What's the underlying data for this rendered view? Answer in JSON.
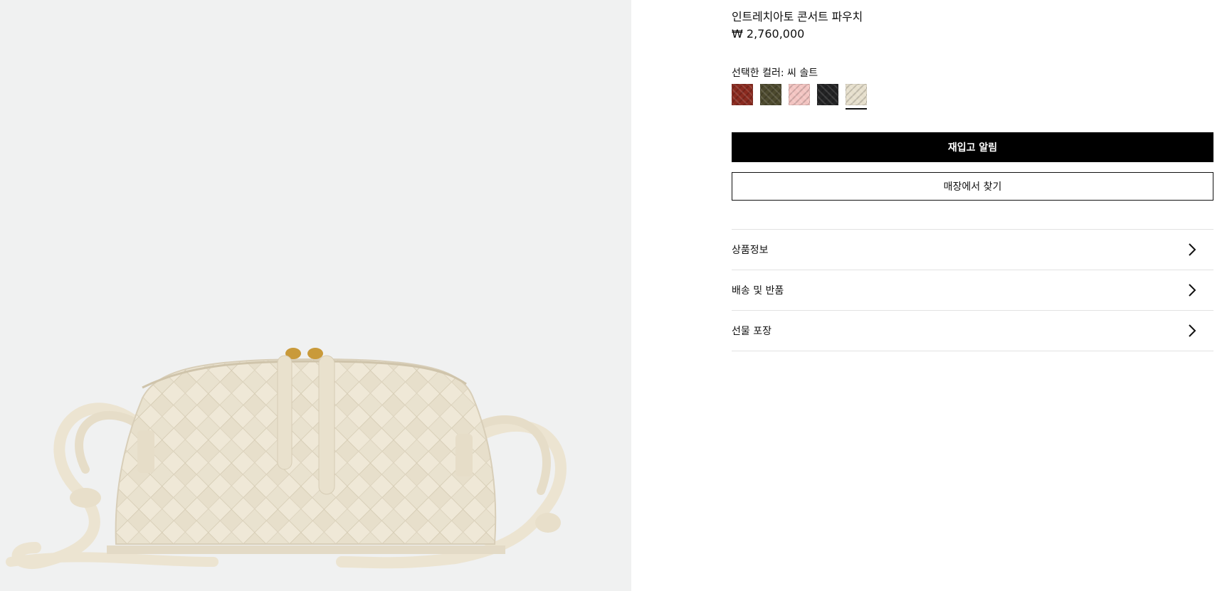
{
  "product": {
    "title": "인트레치아토 콘서트 파우치",
    "price": "₩ 2,760,000"
  },
  "color": {
    "label": "선택한 컬러: 씨 솔트",
    "selected_index": 4,
    "swatches": [
      {
        "color": "#8a2a1f"
      },
      {
        "color": "#4d4a2e"
      },
      {
        "color": "#f3c4c1"
      },
      {
        "color": "#222324"
      },
      {
        "color": "#e6dfcc"
      }
    ]
  },
  "actions": {
    "notify_label": "재입고 알림",
    "store_label": "매장에서 찾기"
  },
  "accordion": [
    {
      "label": "상품정보",
      "icon": "chevron-right-icon"
    },
    {
      "label": "배송 및 반품",
      "icon": "chevron-right-icon"
    },
    {
      "label": "선물 포장",
      "icon": "chevron-right-icon"
    }
  ],
  "colors": {
    "media_background": "#f0f1f1",
    "bag": "#eee6d4",
    "hardware": "#c99a3a",
    "primary_button": "#000000"
  }
}
